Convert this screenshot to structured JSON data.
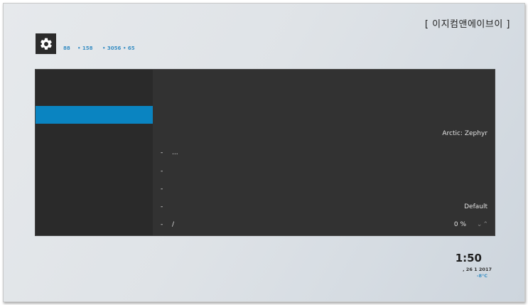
{
  "watermark": "[ 이지컴앤에이브이 ]",
  "header": {
    "icon": "gear-icon",
    "stats": [
      "88",
      "• 158",
      "• 3056",
      "• 65"
    ]
  },
  "panel": {
    "selected_value": "Arctic: Zephyr",
    "rows": [
      {
        "dash": "-",
        "label": "...",
        "value": ""
      },
      {
        "dash": "-",
        "label": "",
        "value": ""
      },
      {
        "dash": "-",
        "label": "",
        "value": ""
      },
      {
        "dash": "-",
        "label": "",
        "value": "Default"
      },
      {
        "dash": "-",
        "label": "/",
        "value": "0 %"
      }
    ],
    "spinner_icons": [
      "chevron-down-icon",
      "chevron-up-icon"
    ]
  },
  "clock": {
    "time": "1:50",
    "date": ", 26 1  2017",
    "temperature": "-8°C"
  },
  "colors": {
    "accent": "#0a84c1",
    "panel": "#323232",
    "stats": "#3b8fc4"
  }
}
